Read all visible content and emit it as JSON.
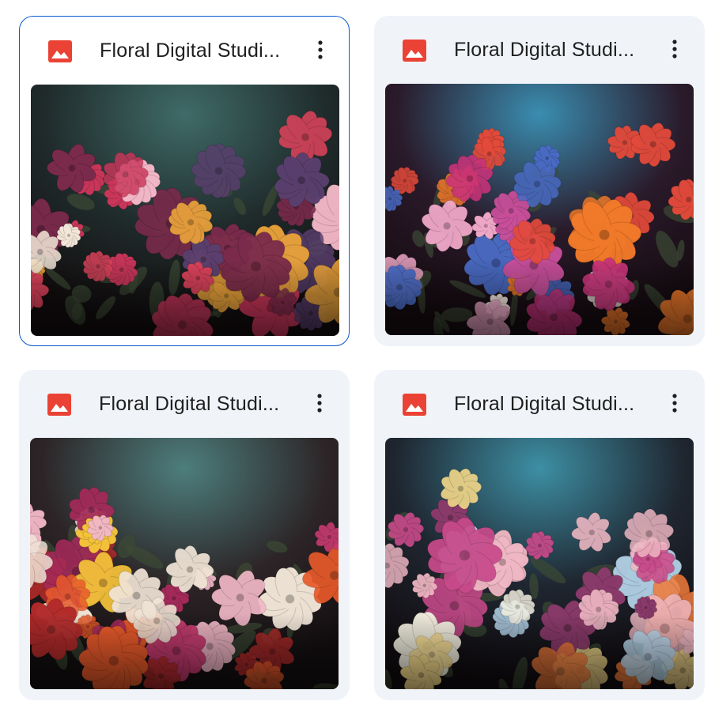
{
  "files": [
    {
      "name": "Floral Digital Studi...",
      "type_icon": "image-file-icon",
      "selected": true,
      "palette": {
        "bg": [
          "#3f6b68",
          "#1f2a2a",
          "#120c0e"
        ],
        "flowers": [
          "#c9365a",
          "#f4b8c8",
          "#f2e6d8",
          "#e9a23b",
          "#7a2a4b",
          "#5a3f6e",
          "#d8425a"
        ]
      }
    },
    {
      "name": "Floral Digital Studi...",
      "type_icon": "image-file-icon",
      "selected": false,
      "palette": {
        "bg": [
          "#3a8db0",
          "#2a1a2a",
          "#150b10"
        ],
        "flowers": [
          "#4a6bc4",
          "#f0a8c8",
          "#f27a2a",
          "#c8337a",
          "#e44a3a",
          "#f5e9e0",
          "#c94f9a"
        ]
      }
    },
    {
      "name": "Floral Digital Studi...",
      "type_icon": "image-file-icon",
      "selected": false,
      "palette": {
        "bg": [
          "#4d7e7d",
          "#2c2426",
          "#130e10"
        ],
        "flowers": [
          "#c43a6e",
          "#f2b8c8",
          "#f5c33a",
          "#e85a2a",
          "#a52a5a",
          "#f0e4d6",
          "#b22a2a"
        ]
      }
    },
    {
      "name": "Floral Digital Studi...",
      "type_icon": "image-file-icon",
      "selected": false,
      "palette": {
        "bg": [
          "#3d8fa4",
          "#1f2630",
          "#110c10"
        ],
        "flowers": [
          "#f3d88a",
          "#f0b8c4",
          "#f07a3a",
          "#b9d8ee",
          "#c84a8a",
          "#f2efe0",
          "#8a3a6a"
        ]
      }
    }
  ],
  "more_actions_icon": "more-vert-icon",
  "colors": {
    "card_bg": "#f0f4f9",
    "selected_border": "#0b57d0",
    "image_icon_red": "#ea4335",
    "title_text": "#1f1f1f"
  }
}
